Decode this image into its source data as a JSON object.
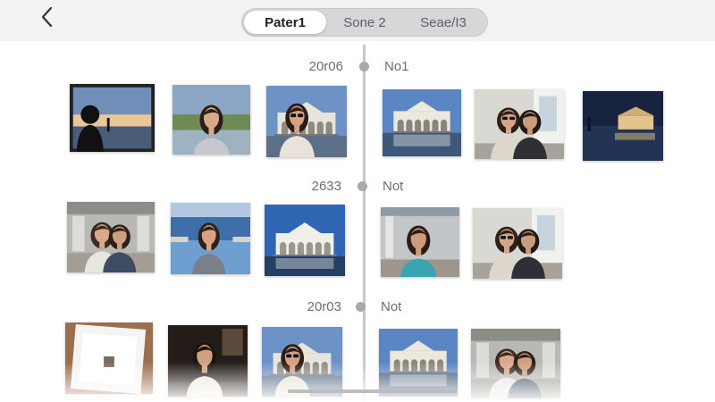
{
  "header": {
    "back_icon": "chevron-left-icon",
    "tabs": [
      {
        "label": "Pater1",
        "active": true
      },
      {
        "label": "Sone 2",
        "active": false
      },
      {
        "label": "Seae/I3",
        "active": false
      }
    ]
  },
  "timeline": {
    "groups": [
      {
        "date": "20r06",
        "tag": "No1"
      },
      {
        "date": "2633",
        "tag": "Not"
      },
      {
        "date": "20r03",
        "tag": "Not"
      }
    ]
  },
  "photos": [
    {
      "subject": "silhouette-sunset"
    },
    {
      "subject": "woman-portrait"
    },
    {
      "subject": "woman-sunglasses-building"
    },
    {
      "subject": "palace-reflection"
    },
    {
      "subject": "two-women-corridor"
    },
    {
      "subject": "palace-night"
    },
    {
      "subject": "two-women-arcade"
    },
    {
      "subject": "woman-lake"
    },
    {
      "subject": "white-palace"
    },
    {
      "subject": "woman-teal-shirt"
    },
    {
      "subject": "two-women-corridor"
    },
    {
      "subject": "framed-print"
    },
    {
      "subject": "woman-dark-room"
    },
    {
      "subject": "woman-sunglasses-building"
    },
    {
      "subject": "palace-reflection"
    },
    {
      "subject": "two-women-arcade"
    }
  ],
  "colors": {
    "topbar": "#f3f3f4",
    "segment_bg": "#d7d7da",
    "axis": "#c7c7c9",
    "dot": "#a9a9ac"
  }
}
